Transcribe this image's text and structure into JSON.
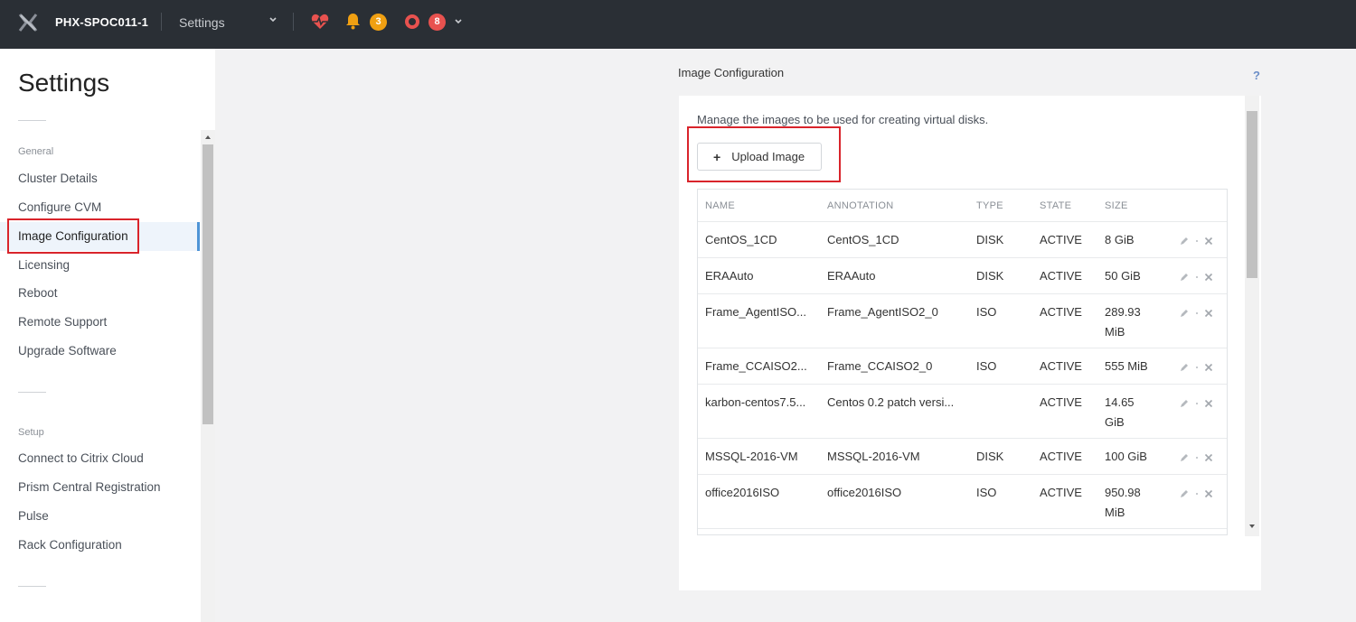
{
  "topbar": {
    "cluster_name": "PHX-SPOC011-1",
    "nav_label": "Settings",
    "alerts_count": "3",
    "critical_count": "8",
    "colors": {
      "background": "#2a2f35",
      "warning": "#f0a012",
      "critical": "#e8524f"
    },
    "icons": [
      "nutanix-logo-icon",
      "chevron-down-icon",
      "health-heart-icon",
      "bell-icon",
      "ring-alert-icon"
    ]
  },
  "sidebar": {
    "title": "Settings",
    "sections": [
      {
        "label": "General",
        "items": [
          "Cluster Details",
          "Configure CVM",
          "Image Configuration",
          "Licensing",
          "Reboot",
          "Remote Support",
          "Upgrade Software"
        ]
      },
      {
        "label": "Setup",
        "items": [
          "Connect to Citrix Cloud",
          "Prism Central Registration",
          "Pulse",
          "Rack Configuration"
        ]
      }
    ],
    "active_item": "Image Configuration"
  },
  "main": {
    "title": "Image Configuration",
    "help": "?",
    "description": "Manage the images to be used for creating virtual disks.",
    "upload_button": "Upload Image",
    "upload_icon": "+",
    "table": {
      "columns": [
        "NAME",
        "ANNOTATION",
        "TYPE",
        "STATE",
        "SIZE"
      ],
      "rows": [
        {
          "name": "CentOS_1CD",
          "annotation": "CentOS_1CD",
          "type": "DISK",
          "state": "ACTIVE",
          "size1": "8 GiB",
          "size2": ""
        },
        {
          "name": "ERAAuto",
          "annotation": "ERAAuto",
          "type": "DISK",
          "state": "ACTIVE",
          "size1": "50 GiB",
          "size2": ""
        },
        {
          "name": "Frame_AgentISO...",
          "annotation": "Frame_AgentISO2_0",
          "type": "ISO",
          "state": "ACTIVE",
          "size1": "289.93",
          "size2": "MiB"
        },
        {
          "name": "Frame_CCAISO2...",
          "annotation": "Frame_CCAISO2_0",
          "type": "ISO",
          "state": "ACTIVE",
          "size1": "555 MiB",
          "size2": ""
        },
        {
          "name": "karbon-centos7.5...",
          "annotation": "Centos 0.2 patch versi...",
          "type": "",
          "state": "ACTIVE",
          "size1": "14.65",
          "size2": "GiB"
        },
        {
          "name": "MSSQL-2016-VM",
          "annotation": "MSSQL-2016-VM",
          "type": "DISK",
          "state": "ACTIVE",
          "size1": "100 GiB",
          "size2": ""
        },
        {
          "name": "office2016ISO",
          "annotation": "office2016ISO",
          "type": "ISO",
          "state": "ACTIVE",
          "size1": "950.98",
          "size2": "MiB"
        }
      ]
    }
  }
}
